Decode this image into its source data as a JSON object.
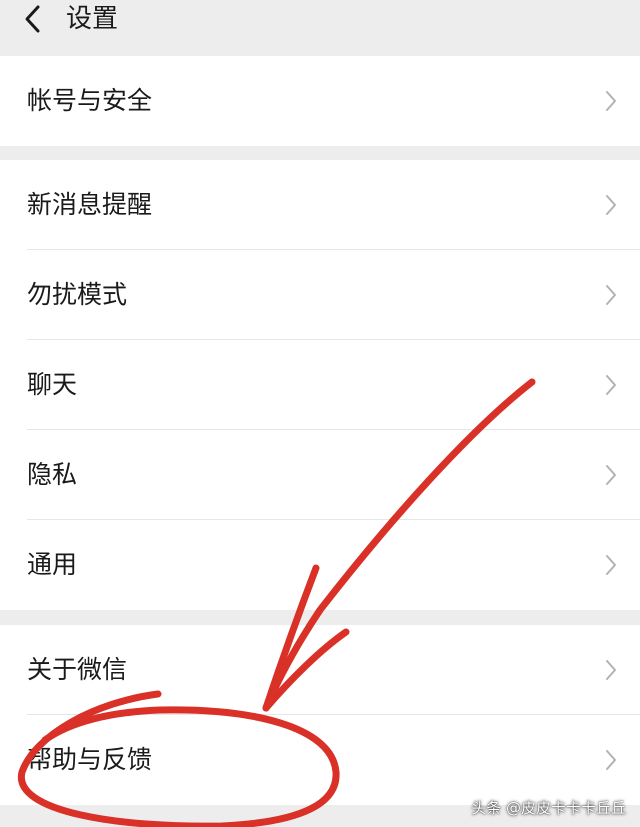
{
  "header": {
    "title": "设置",
    "back_icon": "back-chevron-icon"
  },
  "groups": [
    {
      "items": [
        {
          "label": "帐号与安全"
        }
      ]
    },
    {
      "items": [
        {
          "label": "新消息提醒"
        },
        {
          "label": "勿扰模式"
        },
        {
          "label": "聊天"
        },
        {
          "label": "隐私"
        },
        {
          "label": "通用"
        }
      ]
    },
    {
      "items": [
        {
          "label": "关于微信"
        },
        {
          "label": "帮助与反馈"
        }
      ]
    }
  ],
  "item_icon": "chevron-right-icon",
  "annotation_color": "#d93127",
  "watermark": "头条 @皮皮卡卡卡丘丘"
}
